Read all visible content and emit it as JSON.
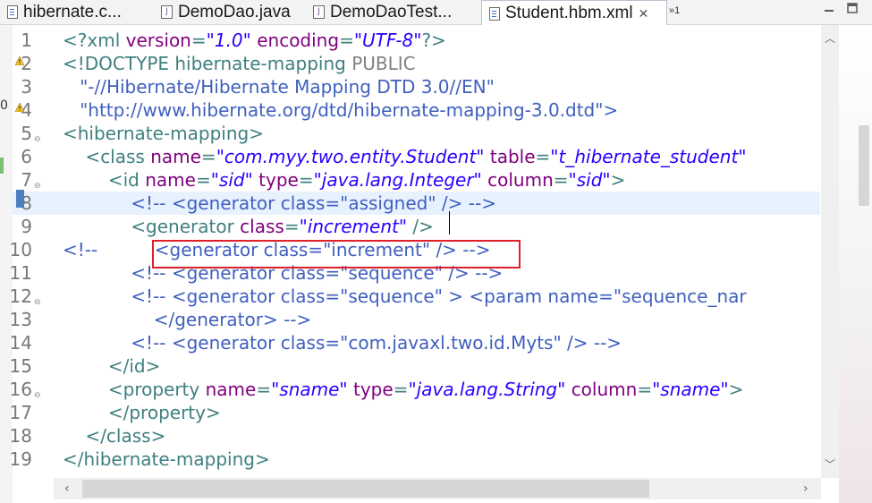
{
  "tabs": [
    {
      "label": "hibernate.c...",
      "icon": "xml-file-icon"
    },
    {
      "label": "DemoDao.java",
      "icon": "java-file-icon"
    },
    {
      "label": "DemoDaoTest...",
      "icon": "java-file-icon"
    },
    {
      "label": "Student.hbm.xml",
      "icon": "xml-file-icon",
      "active": true,
      "close": "✕"
    }
  ],
  "tab_overflow": "»1",
  "left_marker": "0",
  "lines": [
    {
      "n": "1"
    },
    {
      "n": "2"
    },
    {
      "n": "3"
    },
    {
      "n": "4"
    },
    {
      "n": "5"
    },
    {
      "n": "6"
    },
    {
      "n": "7"
    },
    {
      "n": "8"
    },
    {
      "n": "9"
    },
    {
      "n": "10"
    },
    {
      "n": "11"
    },
    {
      "n": "12"
    },
    {
      "n": "13"
    },
    {
      "n": "14"
    },
    {
      "n": "15"
    },
    {
      "n": "16"
    },
    {
      "n": "17"
    },
    {
      "n": "18"
    },
    {
      "n": "19"
    }
  ],
  "code": {
    "l1": {
      "open": "<?xml ",
      "a1": "version",
      "eq1": "=",
      "v1": "\"1.0\"",
      "sp": " ",
      "a2": "encoding",
      "eq2": "=",
      "v2": "\"UTF-8\"",
      "close": "?>"
    },
    "l2": {
      "tag": "<!DOCTYPE hibernate-mapping ",
      "kw": "PUBLIC"
    },
    "l3": {
      "text": "   \"-//Hibernate/Hibernate Mapping DTD 3.0//EN\""
    },
    "l4": {
      "text": "   \"http://www.hibernate.org/dtd/hibernate-mapping-3.0.dtd\">"
    },
    "l5": {
      "text": "<hibernate-mapping>"
    },
    "l6": {
      "open": "    <class ",
      "a1": "name",
      "eq1": "=",
      "v1": "\"com.myy.two.entity.Student\"",
      "sp": " ",
      "a2": "table",
      "eq2": "=",
      "v2": "\"t_hibernate_student\""
    },
    "l7": {
      "open": "        <id ",
      "a1": "name",
      "eq1": "=",
      "v1": "\"sid\"",
      "sp1": " ",
      "a2": "type",
      "eq2": "=",
      "v2": "\"java.lang.Integer\"",
      "sp2": " ",
      "a3": "column",
      "eq3": "=",
      "v3": "\"sid\"",
      "close": ">"
    },
    "l8": {
      "text": "            <!-- <generator class=\"assigned\" /> -->"
    },
    "l9": {
      "open": "            <generator ",
      "a1": "class",
      "eq1": "=",
      "v1": "\"increment\"",
      "close": " />"
    },
    "l10": {
      "text": "<!--          <generator class=\"increment\" /> -->"
    },
    "l11": {
      "text": "            <!-- <generator class=\"sequence\" /> -->"
    },
    "l12": {
      "text": "            <!-- <generator class=\"sequence\" > <param name=\"sequence_nar"
    },
    "l13": {
      "text": "                </generator> -->"
    },
    "l14": {
      "text": "            <!-- <generator class=\"com.javaxl.two.id.Myts\" /> -->"
    },
    "l15": {
      "text": "        </id>"
    },
    "l16": {
      "open": "        <property ",
      "a1": "name",
      "eq1": "=",
      "v1": "\"sname\"",
      "sp1": " ",
      "a2": "type",
      "eq2": "=",
      "v2": "\"java.lang.String\"",
      "sp2": " ",
      "a3": "column",
      "eq3": "=",
      "v3": "\"sname\"",
      "close": ">"
    },
    "l17": {
      "text": "        </property>"
    },
    "l18": {
      "text": "    </class>"
    },
    "l19": {
      "text": "</hibernate-mapping>"
    }
  },
  "colors": {
    "tag": "#3f7f7f",
    "attr_name": "#7f007f",
    "attr_value": "#2a00ff",
    "comment": "#3f5fbf",
    "highlight_line": "#e8f2fe",
    "annotation_box": "#e0202a"
  }
}
